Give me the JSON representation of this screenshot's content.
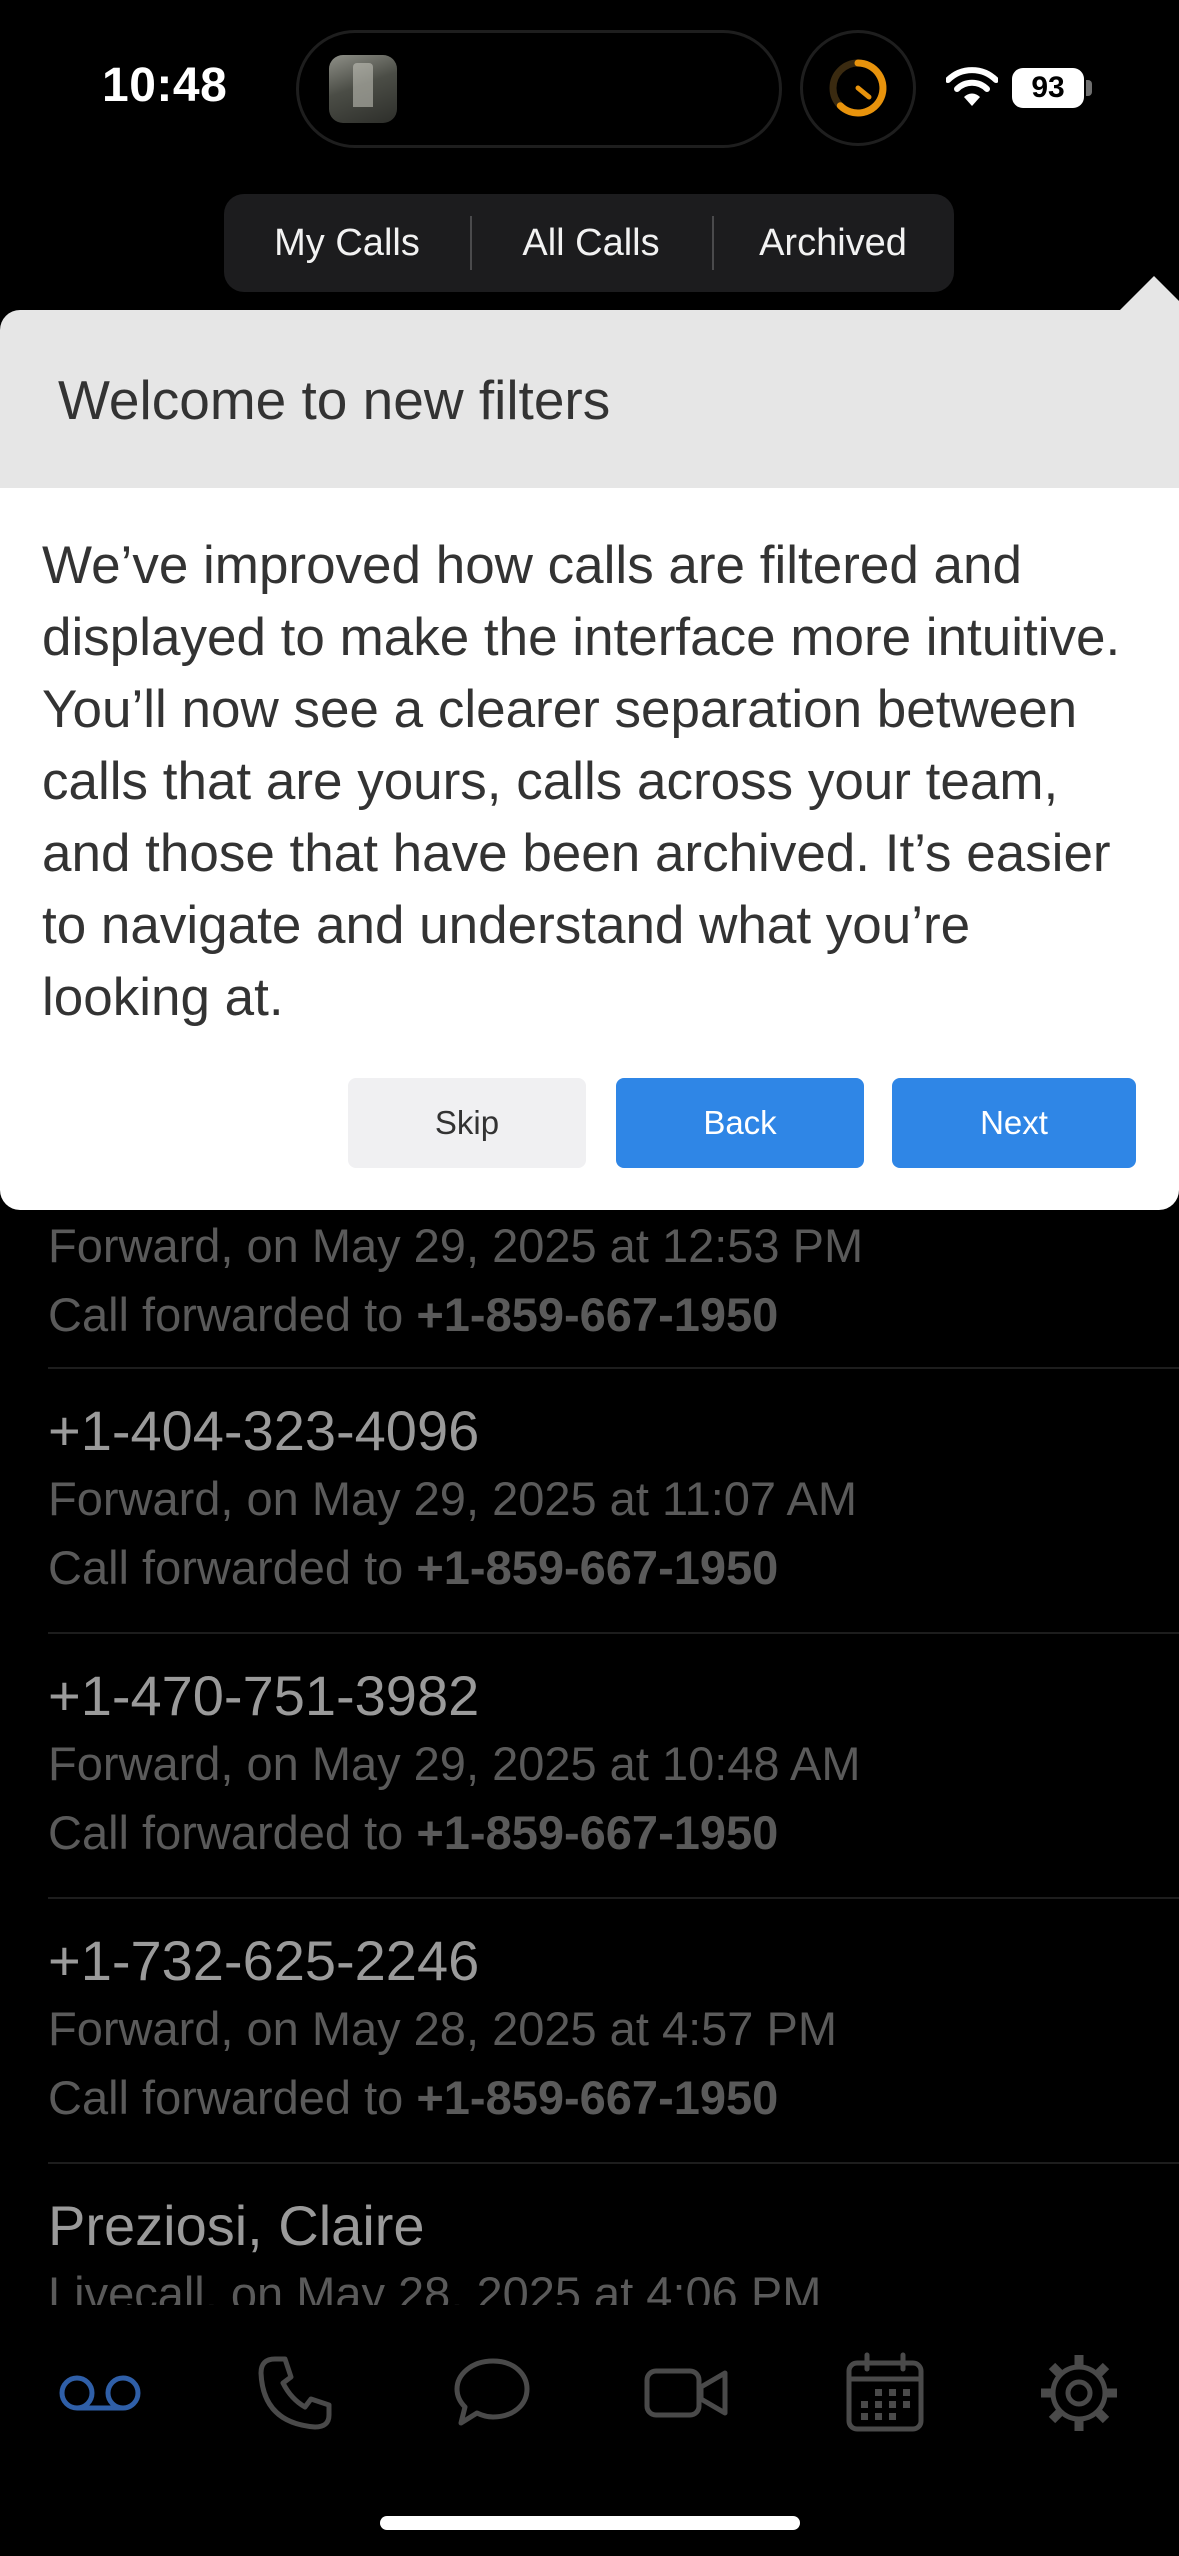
{
  "status_bar": {
    "time": "10:48",
    "battery": "93"
  },
  "filter_tabs": [
    "My Calls",
    "All Calls",
    "Archived"
  ],
  "popover": {
    "title": "Welcome to new filters",
    "body": "We’ve improved how calls are filtered and displayed to make the interface more intuitive. You’ll now see a clearer separation between calls that are yours, calls across your team, and those that have been archived. It’s easier to navigate and understand what you’re looking at.",
    "skip_label": "Skip",
    "back_label": "Back",
    "next_label": "Next"
  },
  "calls": [
    {
      "name": "",
      "meta": "Forward, on May 29, 2025 at 12:53 PM",
      "fwd_prefix": "Call forwarded to ",
      "fwd_number": "+1-859-667-1950"
    },
    {
      "name": "+1-404-323-4096",
      "meta": "Forward, on May 29, 2025 at 11:07 AM",
      "fwd_prefix": "Call forwarded to ",
      "fwd_number": "+1-859-667-1950"
    },
    {
      "name": "+1-470-751-3982",
      "meta": "Forward, on May 29, 2025 at 10:48 AM",
      "fwd_prefix": "Call forwarded to ",
      "fwd_number": "+1-859-667-1950"
    },
    {
      "name": "+1-732-625-2246",
      "meta": "Forward, on May 28, 2025 at 4:57 PM",
      "fwd_prefix": "Call forwarded to ",
      "fwd_number": "+1-859-667-1950"
    },
    {
      "name": "Preziosi, Claire",
      "meta": "Livecall, on May 28, 2025 at 4:06 PM",
      "fwd_prefix": "",
      "fwd_number": ""
    }
  ],
  "tab_bar": {
    "icons": [
      "voicemail-icon",
      "phone-icon",
      "chat-icon",
      "video-icon",
      "calendar-icon",
      "settings-icon"
    ],
    "active_color": "#2f5fa8",
    "inactive_color": "#4a4a4a"
  },
  "colors": {
    "accent": "#2f86e6",
    "timer": "#e8930c"
  }
}
